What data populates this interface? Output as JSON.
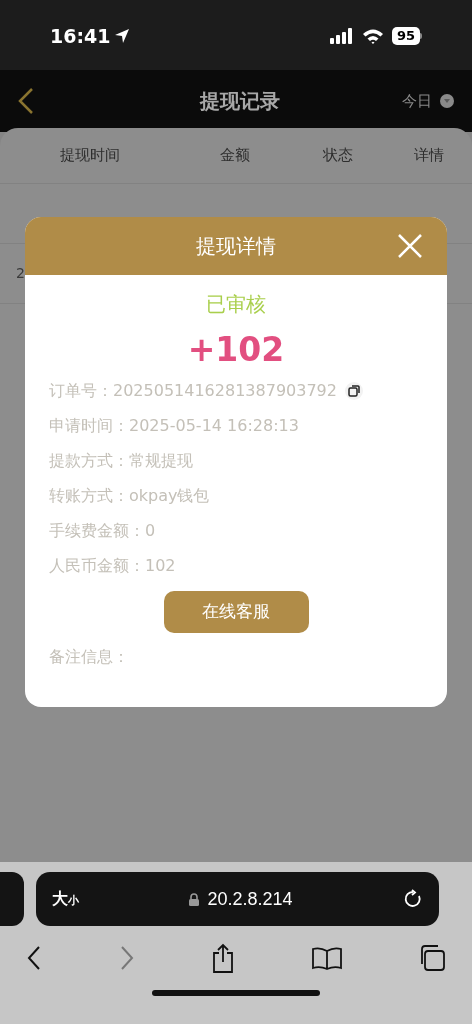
{
  "status_bar": {
    "time": "16:41",
    "battery": "95"
  },
  "header": {
    "title": "提现记录",
    "filter": "今日"
  },
  "table": {
    "columns": [
      "提现时间",
      "金额",
      "状态",
      "详情"
    ],
    "rows": [
      {
        "cells": [
          "2"
        ]
      }
    ]
  },
  "dialog": {
    "title": "提现详情",
    "status": "已审核",
    "amount": "+102",
    "fields": [
      {
        "label": "订单号：",
        "value": "2025051416281387903792",
        "copyable": true
      },
      {
        "label": "申请时间：",
        "value": "2025-05-14 16:28:13",
        "copyable": false
      },
      {
        "label": "提款方式：",
        "value": "常规提现",
        "copyable": false
      },
      {
        "label": "转账方式：",
        "value": "okpay钱包",
        "copyable": false
      },
      {
        "label": "手续费金额：",
        "value": "0",
        "copyable": false
      },
      {
        "label": "人民币金额：",
        "value": "102",
        "copyable": false
      }
    ],
    "button": "在线客服",
    "note_label": "备注信息："
  },
  "browser": {
    "text_size_large": "大",
    "text_size_small": "小",
    "url": "20.2.8.214"
  }
}
